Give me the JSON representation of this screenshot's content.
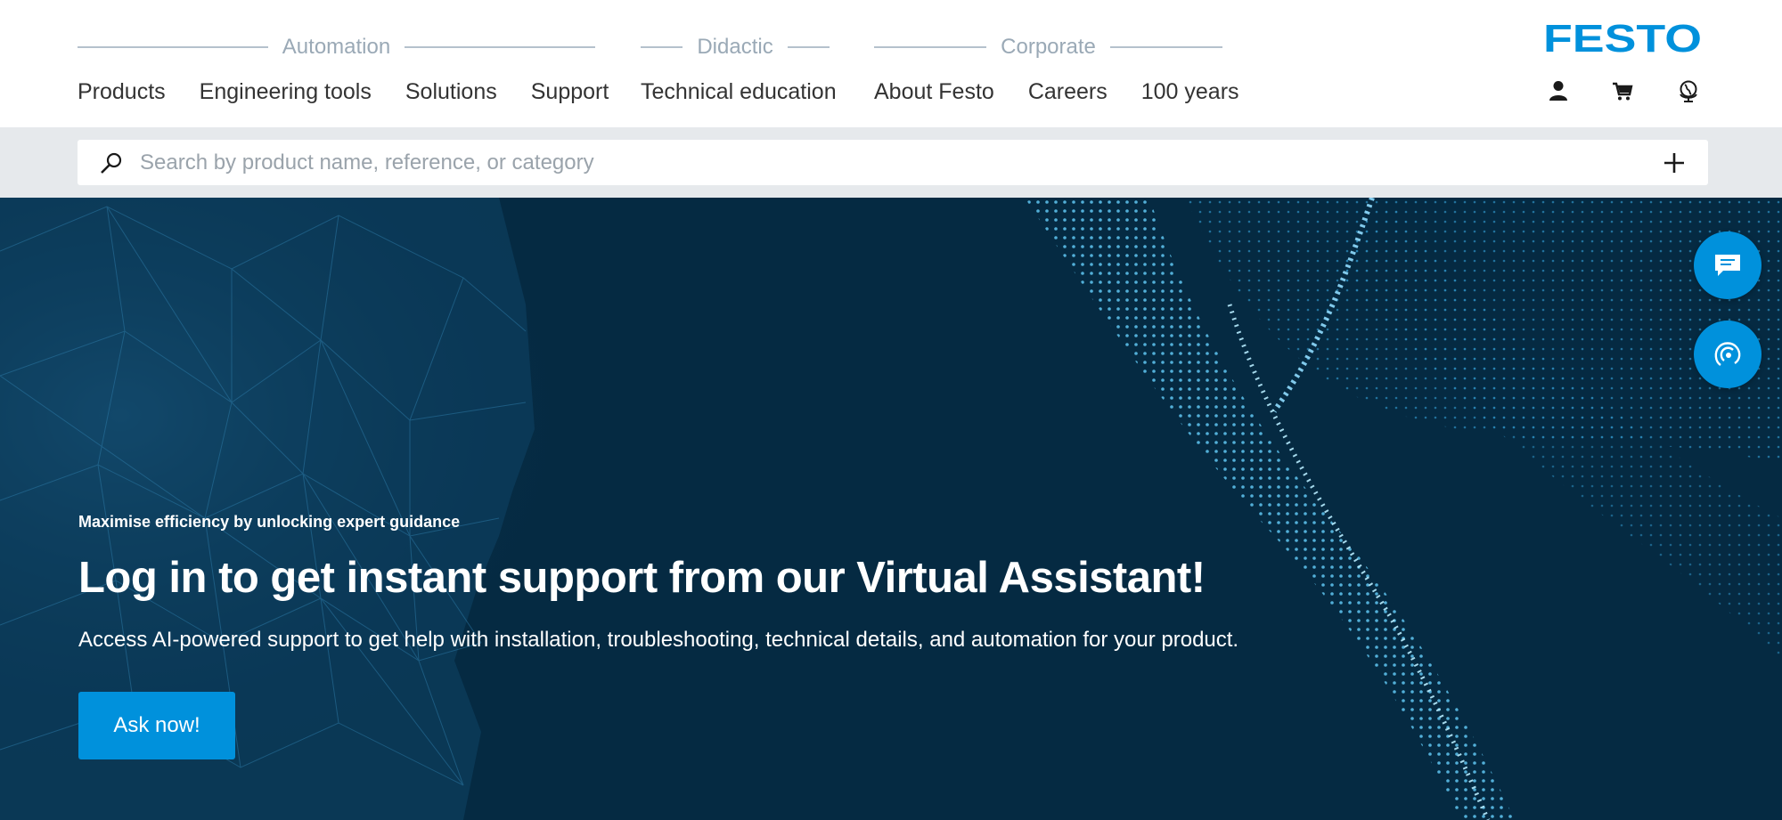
{
  "header": {
    "groups": [
      {
        "label": "Automation",
        "items": [
          "Products",
          "Engineering tools",
          "Solutions",
          "Support"
        ]
      },
      {
        "label": "Didactic",
        "items": [
          "Technical education"
        ]
      },
      {
        "label": "Corporate",
        "items": [
          "About Festo",
          "Careers",
          "100 years"
        ]
      }
    ],
    "logo_text": "FESTO",
    "icons": [
      "user-icon",
      "cart-icon",
      "globe-icon"
    ]
  },
  "search": {
    "placeholder": "Search by product name, reference, or category",
    "value": ""
  },
  "hero": {
    "eyebrow": "Maximise efficiency by unlocking expert guidance",
    "title": "Log in to get instant support from our Virtual Assistant!",
    "description": "Access AI-powered support to get help with installation, troubleshooting, technical details, and automation for your product.",
    "cta_label": "Ask now!"
  },
  "floating_buttons": [
    "chat-icon",
    "support-assistant-icon"
  ],
  "colors": {
    "brand": "#0091dc",
    "hero_bg": "#052a42",
    "group_label": "#9aa9b6",
    "search_strip": "#e6e9ec"
  }
}
